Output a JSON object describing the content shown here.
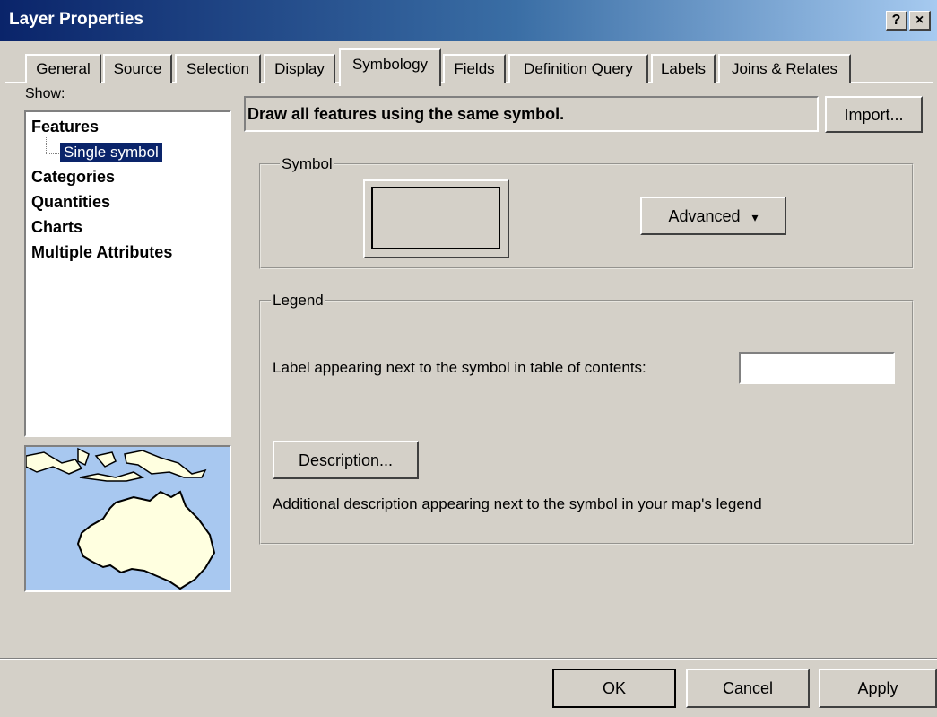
{
  "window": {
    "title": "Layer Properties",
    "help_btn": "?",
    "close_btn": "×"
  },
  "tabs": [
    {
      "label": "General"
    },
    {
      "label": "Source"
    },
    {
      "label": "Selection"
    },
    {
      "label": "Display"
    },
    {
      "label": "Symbology",
      "active": true
    },
    {
      "label": "Fields"
    },
    {
      "label": "Definition Query"
    },
    {
      "label": "Labels"
    },
    {
      "label": "Joins & Relates"
    }
  ],
  "show": {
    "label": "Show:",
    "items": [
      "Features",
      "Categories",
      "Quantities",
      "Charts",
      "Multiple Attributes"
    ],
    "selected_sub": "Single symbol"
  },
  "header": {
    "description": "Draw all features using the same symbol.",
    "import_label": "Import..."
  },
  "symbol_group": {
    "label": "Symbol",
    "advanced_label_pre": "Adva",
    "advanced_label_accel": "n",
    "advanced_label_post": "ced",
    "advanced_arrow": "▾"
  },
  "legend_group": {
    "label": "Legend",
    "label_prompt": "Label appearing next to the symbol in table of contents:",
    "label_value": "",
    "description_btn": "Description...",
    "description_note": "Additional description appearing next to the symbol in your map's legend"
  },
  "footer": {
    "ok": "OK",
    "cancel": "Cancel",
    "apply": "Apply"
  },
  "colors": {
    "dialog_bg": "#d4d0c8",
    "title_start": "#0a246a",
    "title_end": "#a6caf0",
    "selection": "#0a246a",
    "map_water": "#a8c8f0",
    "map_land": "#ffffe0"
  }
}
